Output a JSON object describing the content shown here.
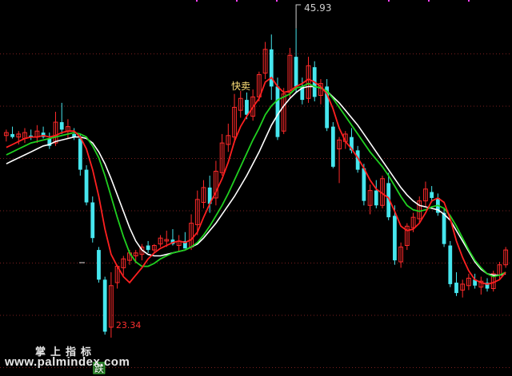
{
  "chart_data": {
    "type": "candlestick",
    "ylim": [
      22.0,
      46.5
    ],
    "grid": "horizontal-dotted",
    "colors": {
      "background": "#000000",
      "grid": "#7a1f1f",
      "up": "#ff2a2a",
      "down": "#46e6ee",
      "ma_fast": "#ff2020",
      "ma_mid": "#20d020",
      "ma_slow": "#ffffff",
      "max_label": "#cfcfcf",
      "min_label": "#ff3030",
      "marker_top": "#ff40ff"
    },
    "x_count": 82,
    "candles": [
      [
        37.7,
        38.1,
        37.3,
        37.9
      ],
      [
        37.8,
        38.3,
        37.5,
        37.6
      ],
      [
        37.6,
        38.0,
        37.1,
        37.8
      ],
      [
        37.5,
        38.2,
        37.2,
        37.9
      ],
      [
        37.7,
        38.1,
        37.4,
        37.6
      ],
      [
        37.6,
        38.4,
        37.2,
        38.0
      ],
      [
        37.9,
        38.3,
        37.5,
        37.6
      ],
      [
        37.5,
        37.9,
        36.8,
        37.0
      ],
      [
        37.2,
        39.3,
        37.0,
        38.6
      ],
      [
        38.6,
        39.9,
        37.8,
        38.1
      ],
      [
        38.0,
        38.8,
        37.5,
        38.3
      ],
      [
        37.8,
        38.2,
        37.4,
        37.6
      ],
      [
        37.5,
        37.8,
        35.0,
        35.4
      ],
      [
        35.4,
        35.7,
        33.0,
        33.2
      ],
      [
        33.2,
        33.6,
        30.5,
        30.8
      ],
      [
        30.0,
        30.2,
        27.8,
        28.0
      ],
      [
        28.0,
        28.2,
        24.3,
        24.5
      ],
      [
        24.8,
        28.5,
        24.1,
        27.6
      ],
      [
        27.8,
        29.0,
        27.4,
        28.9
      ],
      [
        28.8,
        29.6,
        28.3,
        29.4
      ],
      [
        29.3,
        30.0,
        29.0,
        29.8
      ],
      [
        29.6,
        30.0,
        29.1,
        29.8
      ],
      [
        29.7,
        30.4,
        29.3,
        30.2
      ],
      [
        30.3,
        30.6,
        29.8,
        30.0
      ],
      [
        30.0,
        30.4,
        29.8,
        30.3
      ],
      [
        30.4,
        31.0,
        30.2,
        30.8
      ],
      [
        30.6,
        31.3,
        30.2,
        30.7
      ],
      [
        30.7,
        31.4,
        30.3,
        30.4
      ],
      [
        30.3,
        31.0,
        29.9,
        30.6
      ],
      [
        30.6,
        31.2,
        30.1,
        30.1
      ],
      [
        30.2,
        32.4,
        30.0,
        31.8
      ],
      [
        31.7,
        34.0,
        31.0,
        33.4
      ],
      [
        33.2,
        34.7,
        32.8,
        34.2
      ],
      [
        34.2,
        35.0,
        32.5,
        33.1
      ],
      [
        33.5,
        36.0,
        33.0,
        35.3
      ],
      [
        35.2,
        37.8,
        35.0,
        37.2
      ],
      [
        37.1,
        38.5,
        36.6,
        37.7
      ],
      [
        37.6,
        40.5,
        37.2,
        39.6
      ],
      [
        39.4,
        40.7,
        38.9,
        40.2
      ],
      [
        40.1,
        40.6,
        38.8,
        39.1
      ],
      [
        39.0,
        40.8,
        38.7,
        40.3
      ],
      [
        40.3,
        42.0,
        40.0,
        41.8
      ],
      [
        41.9,
        44.0,
        41.5,
        43.5
      ],
      [
        43.5,
        44.5,
        40.1,
        41.0
      ],
      [
        41.0,
        41.6,
        37.4,
        37.6
      ],
      [
        38.0,
        40.9,
        37.8,
        40.5
      ],
      [
        40.6,
        43.6,
        40.2,
        43.1
      ],
      [
        43.0,
        44.9,
        40.6,
        41.0
      ],
      [
        41.0,
        41.6,
        39.8,
        40.1
      ],
      [
        40.2,
        43.0,
        39.9,
        42.4
      ],
      [
        42.3,
        42.7,
        40.0,
        40.3
      ],
      [
        40.4,
        41.5,
        39.8,
        41.2
      ],
      [
        41.0,
        41.5,
        38.0,
        38.2
      ],
      [
        38.3,
        38.6,
        35.5,
        35.6
      ],
      [
        36.8,
        37.6,
        34.5,
        37.4
      ],
      [
        37.3,
        38.0,
        36.8,
        37.8
      ],
      [
        37.6,
        38.2,
        36.5,
        36.7
      ],
      [
        36.7,
        37.0,
        35.2,
        35.4
      ],
      [
        35.5,
        35.8,
        33.0,
        33.3
      ],
      [
        33.0,
        34.4,
        32.4,
        34.0
      ],
      [
        34.0,
        34.7,
        32.8,
        33.0
      ],
      [
        33.0,
        35.0,
        32.8,
        34.8
      ],
      [
        34.5,
        35.2,
        32.0,
        32.2
      ],
      [
        32.3,
        33.0,
        29.0,
        29.3
      ],
      [
        29.2,
        30.5,
        28.8,
        30.2
      ],
      [
        30.3,
        31.8,
        30.0,
        31.6
      ],
      [
        31.5,
        32.5,
        31.2,
        32.2
      ],
      [
        32.1,
        33.6,
        31.8,
        33.3
      ],
      [
        33.3,
        34.6,
        32.9,
        34.1
      ],
      [
        33.9,
        34.3,
        33.2,
        33.5
      ],
      [
        33.5,
        33.8,
        32.3,
        32.5
      ],
      [
        32.5,
        32.8,
        30.2,
        30.4
      ],
      [
        30.3,
        30.6,
        27.5,
        27.7
      ],
      [
        27.8,
        28.5,
        26.9,
        27.1
      ],
      [
        27.3,
        28.0,
        26.8,
        27.7
      ],
      [
        27.6,
        28.4,
        27.3,
        28.1
      ],
      [
        28.0,
        28.4,
        27.4,
        27.6
      ],
      [
        27.5,
        28.2,
        27.0,
        27.9
      ],
      [
        27.8,
        28.1,
        27.2,
        27.4
      ],
      [
        27.4,
        28.6,
        27.2,
        28.4
      ],
      [
        28.3,
        29.2,
        28.0,
        29.0
      ],
      [
        29.0,
        30.2,
        28.8,
        30.0
      ]
    ],
    "ma_fast": [
      36.9,
      37.1,
      37.3,
      37.5,
      37.6,
      37.6,
      37.7,
      37.6,
      37.7,
      37.9,
      38.0,
      38.0,
      37.6,
      36.8,
      35.4,
      33.6,
      31.4,
      29.7,
      28.9,
      28.2,
      27.8,
      28.3,
      28.8,
      29.4,
      29.8,
      30.1,
      30.3,
      30.5,
      30.6,
      30.5,
      30.7,
      31.2,
      32.2,
      33.1,
      33.9,
      34.8,
      35.9,
      37.3,
      38.3,
      39.0,
      39.6,
      40.2,
      41.3,
      41.6,
      41.0,
      40.6,
      40.7,
      41.0,
      41.2,
      41.5,
      41.3,
      41.0,
      40.5,
      39.5,
      38.2,
      37.3,
      36.8,
      36.2,
      35.5,
      34.7,
      34.1,
      33.8,
      33.5,
      32.6,
      31.6,
      31.3,
      31.4,
      31.8,
      32.5,
      33.3,
      33.5,
      33.2,
      32.1,
      30.6,
      29.5,
      28.6,
      28.0,
      27.8,
      27.7,
      27.8,
      28.0,
      28.5
    ],
    "ma_mid": [
      36.4,
      36.6,
      36.8,
      37.0,
      37.2,
      37.3,
      37.4,
      37.5,
      37.6,
      37.7,
      37.8,
      37.9,
      37.8,
      37.6,
      37.0,
      36.2,
      35.0,
      33.6,
      32.2,
      30.9,
      29.8,
      29.2,
      28.9,
      28.9,
      29.1,
      29.4,
      29.6,
      29.8,
      29.9,
      30.0,
      30.2,
      30.5,
      31.0,
      31.6,
      32.3,
      33.0,
      33.8,
      34.7,
      35.6,
      36.5,
      37.4,
      38.2,
      39.1,
      39.7,
      40.1,
      40.3,
      40.5,
      40.9,
      41.0,
      41.2,
      41.0,
      40.9,
      40.7,
      40.2,
      39.6,
      39.0,
      38.4,
      37.8,
      37.2,
      36.6,
      36.1,
      35.6,
      35.0,
      34.3,
      33.6,
      33.0,
      32.7,
      32.6,
      32.7,
      32.9,
      33.0,
      32.8,
      32.3,
      31.6,
      30.8,
      30.0,
      29.3,
      28.8,
      28.4,
      28.2,
      28.3,
      28.5
    ],
    "ma_slow": [
      35.8,
      36.0,
      36.2,
      36.4,
      36.6,
      36.8,
      37.0,
      37.1,
      37.3,
      37.4,
      37.5,
      37.6,
      37.6,
      37.5,
      37.2,
      36.6,
      35.8,
      34.8,
      33.7,
      32.6,
      31.5,
      30.6,
      30.0,
      29.7,
      29.6,
      29.6,
      29.7,
      29.8,
      29.9,
      30.0,
      30.2,
      30.4,
      30.8,
      31.3,
      31.8,
      32.4,
      33.0,
      33.6,
      34.3,
      35.0,
      35.8,
      36.6,
      37.5,
      38.4,
      39.1,
      39.7,
      40.2,
      40.6,
      40.9,
      41.0,
      41.0,
      40.9,
      40.7,
      40.3,
      39.9,
      39.4,
      38.9,
      38.4,
      37.8,
      37.2,
      36.6,
      36.0,
      35.4,
      34.8,
      34.2,
      33.7,
      33.3,
      33.0,
      32.9,
      32.8,
      32.7,
      32.4,
      32.0,
      31.3,
      30.6,
      29.9,
      29.2,
      28.7,
      28.4,
      28.3,
      28.3,
      28.4
    ],
    "max_label": "45.93",
    "min_label": "23.34",
    "sell_label": "快卖",
    "fall_label": "跌",
    "watermark_line1": "掌上指标",
    "watermark_line2": "www.palmindex.com"
  }
}
